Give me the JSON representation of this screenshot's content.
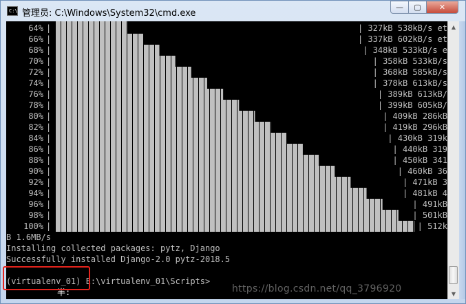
{
  "window": {
    "title": "管理员: C:\\Windows\\System32\\cmd.exe",
    "icon": "cmd-icon",
    "icon_text": "C:\\",
    "buttons": {
      "minimize": "—",
      "maximize": "▢",
      "close": "✕"
    }
  },
  "console": {
    "progress_rows": [
      {
        "pct": "64%",
        "speed": "| 327kB 538kB/s et",
        "fill": 0.64
      },
      {
        "pct": "66%",
        "speed": "| 337kB 602kB/s et",
        "fill": 0.66
      },
      {
        "pct": "68%",
        "speed": "| 348kB 533kB/s e",
        "fill": 0.68
      },
      {
        "pct": "70%",
        "speed": "| 358kB 533kB/s",
        "fill": 0.7
      },
      {
        "pct": "72%",
        "speed": "| 368kB 585kB/s",
        "fill": 0.72
      },
      {
        "pct": "74%",
        "speed": "| 378kB 613kB/s",
        "fill": 0.74
      },
      {
        "pct": "76%",
        "speed": "| 389kB 613kB/",
        "fill": 0.76
      },
      {
        "pct": "78%",
        "speed": "| 399kB 605kB/",
        "fill": 0.78
      },
      {
        "pct": "80%",
        "speed": "| 409kB 286kB",
        "fill": 0.8
      },
      {
        "pct": "82%",
        "speed": "| 419kB 296kB",
        "fill": 0.82
      },
      {
        "pct": "84%",
        "speed": "| 430kB 319k",
        "fill": 0.84
      },
      {
        "pct": "86%",
        "speed": "| 440kB 319",
        "fill": 0.86
      },
      {
        "pct": "88%",
        "speed": "| 450kB 341",
        "fill": 0.88
      },
      {
        "pct": "90%",
        "speed": "| 460kB 36",
        "fill": 0.9
      },
      {
        "pct": "92%",
        "speed": "| 471kB 3",
        "fill": 0.92
      },
      {
        "pct": "94%",
        "speed": "| 481kB 4",
        "fill": 0.94
      },
      {
        "pct": "96%",
        "speed": "| 491kB",
        "fill": 0.96
      },
      {
        "pct": "98%",
        "speed": "| 501kB",
        "fill": 0.98
      },
      {
        "pct": "100%",
        "speed": "| 512k",
        "fill": 1.0
      }
    ],
    "line_speed": "B 1.6MB/s",
    "line_installing": "Installing collected packages: pytz, Django",
    "line_success": "Successfully installed Django-2.0 pytz-2018.5",
    "prompt_env": "(virtualenv_01)",
    "prompt_path": " E:\\virtualenv_01\\Scripts>",
    "ime_text": "半:"
  },
  "watermark": "https://blog.csdn.net/qq_3796920",
  "colors": {
    "console_bg": "#000000",
    "console_text": "#c0c0c0",
    "bar_fill": "#c0c0c0",
    "highlight": "#e5231c",
    "title_gradient": "#dbe7f5"
  }
}
